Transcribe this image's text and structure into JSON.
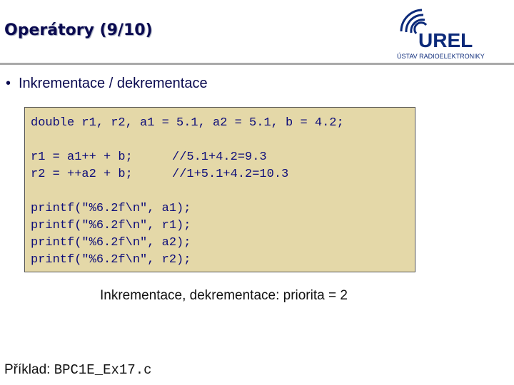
{
  "slide": {
    "title": "Operátory (9/10)",
    "logo_text": "UREL",
    "logo_subtext": "ÚSTAV RADIOELEKTRONIKY",
    "bullet_marker": "•",
    "bullet_text": "Inkrementace / dekrementace",
    "code": {
      "declaration": "double r1, r2, a1 = 5.1, a2 = 5.1, b = 4.2;",
      "stmt1": "r1 = a1++ + b;",
      "comment1": "//5.1+4.2=9.3",
      "stmt2": "r2 = ++a2 + b;",
      "comment2": "//1+5.1+4.2=10.3",
      "printf_lines": [
        "printf(\"%6.2f\\n\", a1);",
        "printf(\"%6.2f\\n\", r1);",
        "printf(\"%6.2f\\n\", a2);",
        "printf(\"%6.2f\\n\", r2);"
      ]
    },
    "note": "Inkrementace, dekrementace: priorita = 2",
    "example_label": "Příklad:",
    "example_code": "BPC1E_Ex17.c"
  },
  "colors": {
    "title": "#0a0a50",
    "code_background": "#e4d8a8",
    "code_text": "#0d0d7a",
    "punctuation": "#8b0000",
    "logo": "#0c2a7a"
  }
}
